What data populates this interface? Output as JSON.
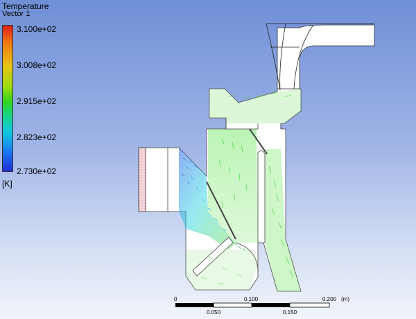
{
  "legend": {
    "title": "Temperature",
    "subtitle": "Vector 1",
    "ticks": [
      "3.100e+02",
      "3.008e+02",
      "2.915e+02",
      "2.823e+02",
      "2.730e+02"
    ],
    "unit": "[K]"
  },
  "scale_bar": {
    "top_labels": [
      "0",
      "0.100",
      "0.200"
    ],
    "bottom_labels": [
      "0.050",
      "0.150"
    ],
    "unit": "(m)"
  },
  "colors": {
    "hot": "#e0201a",
    "warm": "#e6c514",
    "mid": "#33d51b",
    "cool": "#12c7df",
    "cold": "#1f2fd8"
  }
}
